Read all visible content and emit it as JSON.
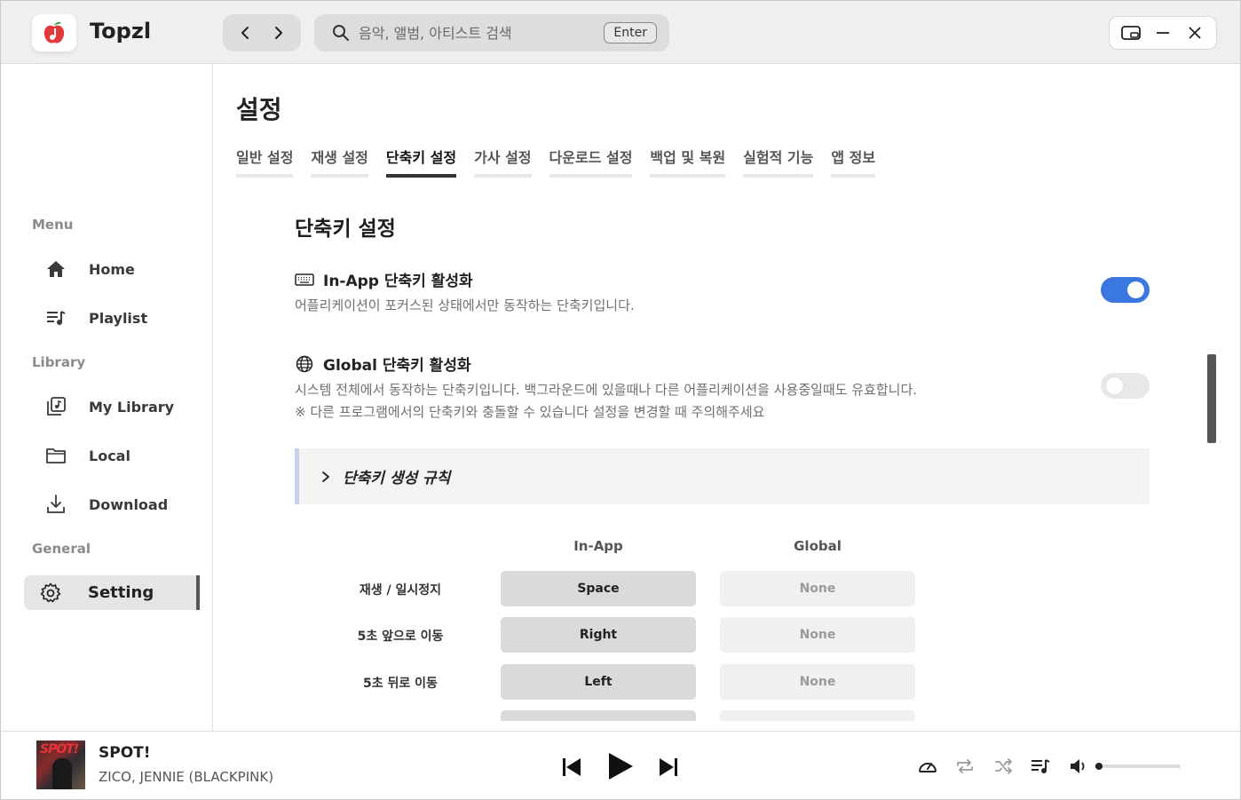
{
  "app": {
    "name": "Topzl"
  },
  "search": {
    "placeholder": "음악, 앨범, 아티스트 검색",
    "value": "",
    "enter_label": "Enter"
  },
  "sidebar": {
    "sections": [
      {
        "heading": "Menu",
        "items": [
          {
            "label": "Home",
            "icon": "home-icon"
          },
          {
            "label": "Playlist",
            "icon": "playlist-icon"
          }
        ]
      },
      {
        "heading": "Library",
        "items": [
          {
            "label": "My Library",
            "icon": "library-icon"
          },
          {
            "label": "Local",
            "icon": "folder-icon"
          },
          {
            "label": "Download",
            "icon": "download-icon"
          }
        ]
      },
      {
        "heading": "General",
        "items": [
          {
            "label": "Setting",
            "icon": "gear-icon",
            "active": true
          }
        ]
      }
    ]
  },
  "page": {
    "title": "설정",
    "tabs": [
      {
        "label": "일반 설정"
      },
      {
        "label": "재생 설정"
      },
      {
        "label": "단축키 설정",
        "active": true
      },
      {
        "label": "가사 설정"
      },
      {
        "label": "다운로드 설정"
      },
      {
        "label": "백업 및 복원"
      },
      {
        "label": "실험적 기능"
      },
      {
        "label": "앱 정보"
      }
    ]
  },
  "shortcuts": {
    "section_title": "단축키 설정",
    "inapp_option": {
      "title": "In-App 단축키 활성화",
      "description": "어플리케이션이 포커스된 상태에서만 동작하는 단축키입니다.",
      "enabled": true,
      "icon": "keyboard-icon"
    },
    "global_option": {
      "title": "Global 단축키 활성화",
      "description": "시스템 전체에서 동작하는 단축키입니다. 백그라운드에 있을때나 다른 어플리케이션을 사용중일때도 유효합니다.",
      "warning": "※ 다른 프로그램에서의 단축키와 충돌할 수 있습니다 설정을 변경할 때 주의해주세요",
      "enabled": false,
      "icon": "globe-icon"
    },
    "rules_label": "단축키 생성 규칙",
    "columns": {
      "inapp": "In-App",
      "global": "Global"
    },
    "rows": [
      {
        "action": "재생 / 일시정지",
        "inapp": "Space",
        "global": "None"
      },
      {
        "action": "5초 앞으로 이동",
        "inapp": "Right",
        "global": "None"
      },
      {
        "action": "5초 뒤로 이동",
        "inapp": "Left",
        "global": "None"
      }
    ]
  },
  "player": {
    "title": "SPOT!",
    "artist": "ZICO, JENNIE (BLACKPINK)",
    "album_art_text": "SPOT!",
    "volume": 0.02
  },
  "colors": {
    "accent": "#3a78e0",
    "toggle_off": "#e8e8e8",
    "active_key": "#dadada",
    "inactive_key": "#f0f0f0"
  }
}
